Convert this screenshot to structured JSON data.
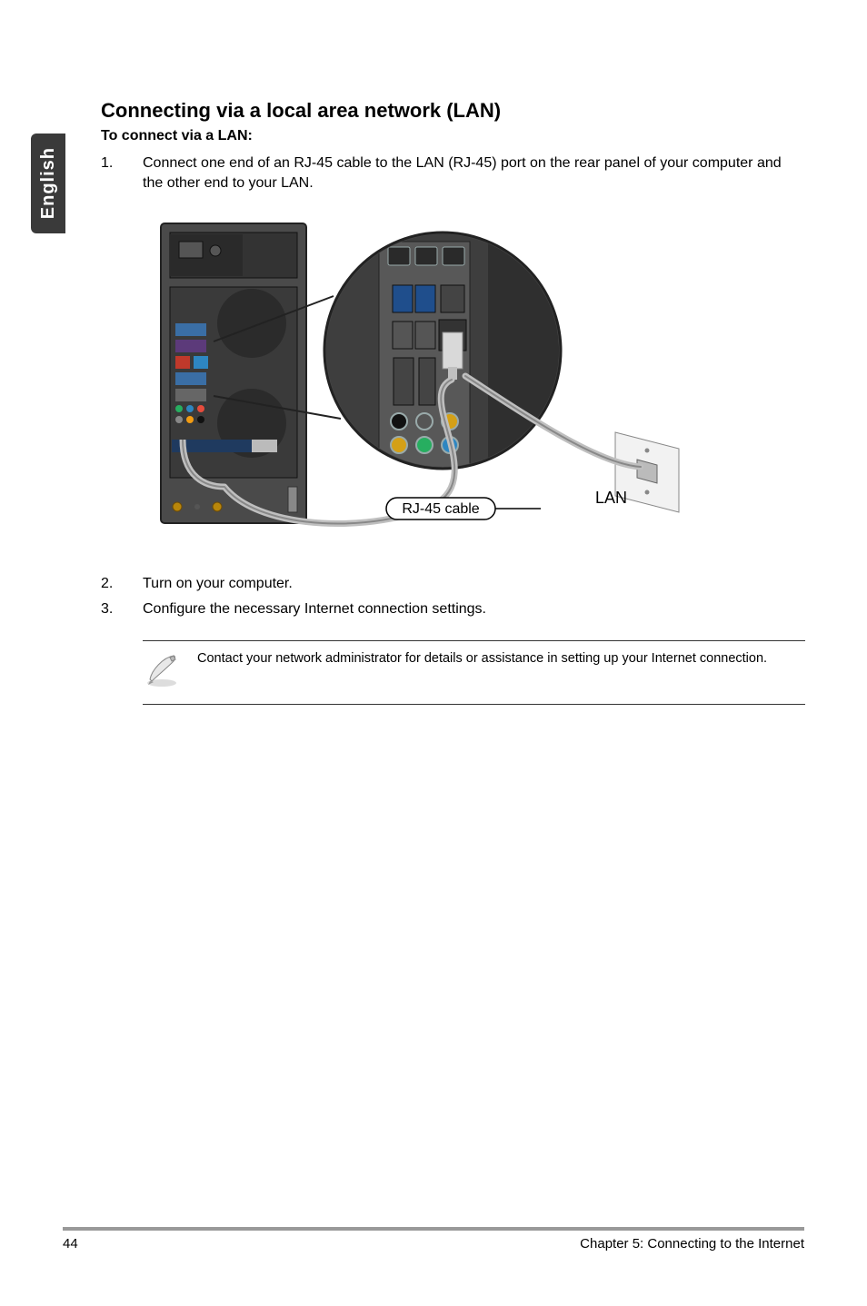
{
  "sidebar": {
    "language": "English"
  },
  "heading": "Connecting via a local area network (LAN)",
  "subheading": "To connect via a LAN:",
  "steps": [
    {
      "num": "1.",
      "text": "Connect one end of an RJ-45 cable to the LAN (RJ-45) port on the rear panel of your computer and the other end to your LAN."
    },
    {
      "num": "2.",
      "text": "Turn on your computer."
    },
    {
      "num": "3.",
      "text": "Configure the necessary Internet connection settings."
    }
  ],
  "figure": {
    "cable_label": "RJ-45 cable",
    "lan_label": "LAN"
  },
  "note": {
    "text": "Contact your network administrator for details or assistance in setting up your Internet connection."
  },
  "footer": {
    "page_number": "44",
    "chapter": "Chapter 5: Connecting to the Internet"
  }
}
